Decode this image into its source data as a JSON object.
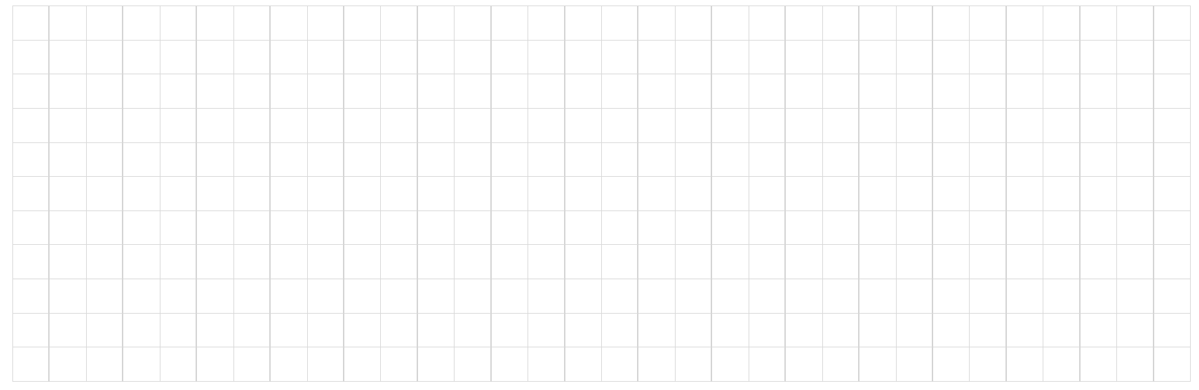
{
  "grid": {
    "columns": 32,
    "rows": 11,
    "line_color": "#d9d9d9",
    "major_line_color": "#d4d4d4",
    "background": "#ffffff"
  }
}
